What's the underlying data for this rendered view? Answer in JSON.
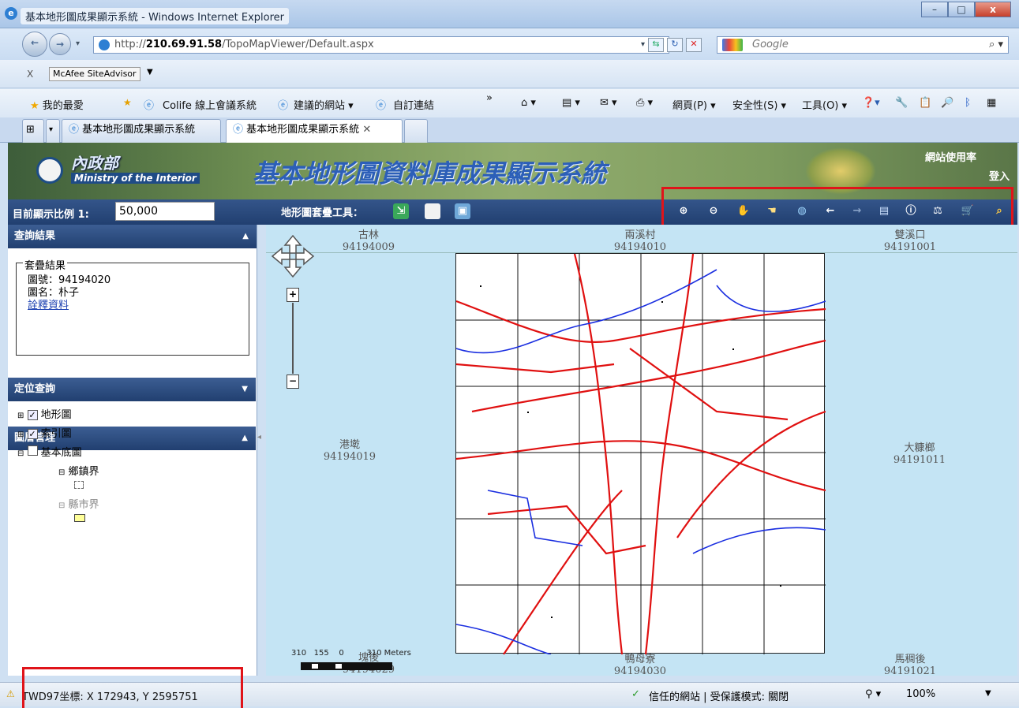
{
  "window": {
    "title": "基本地形圖成果顯示系統 - Windows Internet Explorer",
    "min": "–",
    "max": "□",
    "close": "x"
  },
  "address": {
    "url_prefix": "http://",
    "url_host": "210.69.91.58",
    "url_path": "/TopoMapViewer/Default.aspx",
    "search_placeholder": "Google"
  },
  "mcafee": {
    "close": "X",
    "label": "McAfee SiteAdvisor"
  },
  "favorites": {
    "favorites_label": "我的最愛",
    "items": [
      "Colife 線上會議系統",
      "建議的網站 ▾",
      "自訂連結"
    ],
    "commands": [
      "網頁(P) ▾",
      "安全性(S) ▾",
      "工具(O) ▾"
    ]
  },
  "tabs": [
    {
      "label": "基本地形圖成果顯示系統"
    },
    {
      "label": "基本地形圖成果顯示系統"
    }
  ],
  "banner": {
    "ministry_cn": "內政部",
    "ministry_en": "Ministry of the Interior",
    "system_name": "基本地形圖資料庫成果顯示系統",
    "usage": "網站使用率",
    "login": "登入"
  },
  "toolbar": {
    "scale_label": "目前顯示比例 1:",
    "scale_value": "50,000",
    "overlay_tools_label": "地形圖套疊工具："
  },
  "left_panel": {
    "query_result_title": "查詢結果",
    "overlay_result_legend": "套疊結果",
    "sheet_no": "圖號：94194020",
    "sheet_name": "圖名：朴子",
    "note_link": "詮釋資料",
    "locate_title": "定位查詢",
    "layer_title": "圖層管理",
    "layers": [
      {
        "label": "地形圖",
        "checked": true
      },
      {
        "label": "索引圖",
        "checked": true
      },
      {
        "label": "基本底圖",
        "checked": false
      }
    ],
    "sublayers": [
      {
        "label": "鄉鎮界"
      },
      {
        "label": "縣市界"
      }
    ]
  },
  "map": {
    "sheets": [
      {
        "name": "古林",
        "code": "94194009"
      },
      {
        "name": "兩溪村",
        "code": "94194010"
      },
      {
        "name": "雙溪口",
        "code": "94191001"
      },
      {
        "name": "港墘",
        "code": "94194019"
      },
      {
        "name": "大糠榔",
        "code": "94191011"
      },
      {
        "name": "塊後",
        "code": "94194029"
      },
      {
        "name": "鴨母寮",
        "code": "94194030"
      },
      {
        "name": "馬稠後",
        "code": "94191021"
      }
    ],
    "scale_bar_text": "310   155    0         310 Meters"
  },
  "status": {
    "coords": "TWD97坐標: X 172943, Y 2595751",
    "security": "信任的網站 | 受保護模式: 關閉",
    "zoom": "100%"
  }
}
